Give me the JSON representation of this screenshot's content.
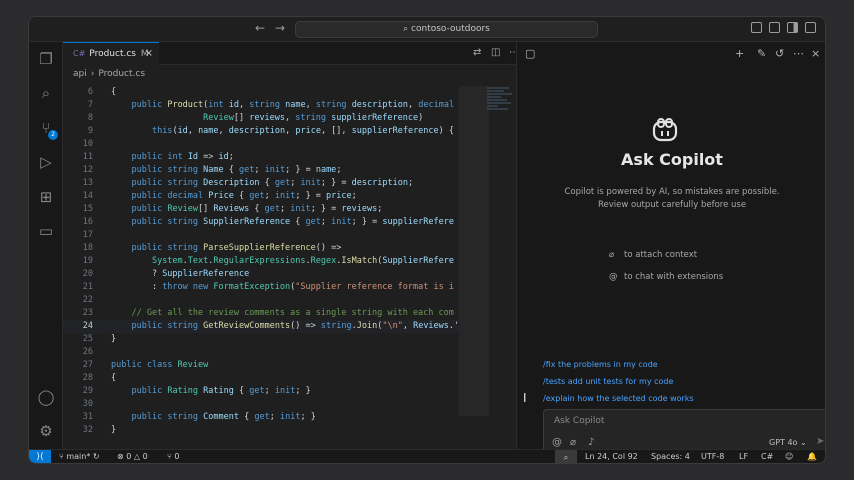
{
  "titlebar": {
    "search_text": "contoso-outdoors"
  },
  "activity_bar": {
    "scm_badge": "2"
  },
  "editor": {
    "tab_label": "Product.cs",
    "tab_modified": "M",
    "breadcrumb": [
      "api",
      "Product.cs"
    ],
    "active_line": 24,
    "lines": [
      {
        "n": 6,
        "html": "{"
      },
      {
        "n": 7,
        "html": "    <span class=\"c-kw\">public</span> <span class=\"c-fn\">Product</span>(<span class=\"c-kw\">int</span> <span class=\"c-p\">id</span>, <span class=\"c-kw\">string</span> <span class=\"c-p\">name</span>, <span class=\"c-kw\">string</span> <span class=\"c-p\">description</span>, <span class=\"c-kw\">decimal</span>"
      },
      {
        "n": 8,
        "html": "                  <span class=\"c-ty\">Review</span>[] <span class=\"c-p\">reviews</span>, <span class=\"c-kw\">string</span> <span class=\"c-p\">supplierReference</span>)"
      },
      {
        "n": 9,
        "html": "        <span class=\"c-kw\">this</span>(<span class=\"c-p\">id</span>, <span class=\"c-p\">name</span>, <span class=\"c-p\">description</span>, <span class=\"c-p\">price</span>, [], <span class=\"c-p\">supplierReference</span>) {"
      },
      {
        "n": 10,
        "html": ""
      },
      {
        "n": 11,
        "html": "    <span class=\"c-kw\">public</span> <span class=\"c-kw\">int</span> <span class=\"c-p\">Id</span> =&gt; <span class=\"c-p\">id</span>;"
      },
      {
        "n": 12,
        "html": "    <span class=\"c-kw\">public</span> <span class=\"c-kw\">string</span> <span class=\"c-p\">Name</span> { <span class=\"c-kw\">get</span>; <span class=\"c-kw\">init</span>; } = <span class=\"c-p\">name</span>;"
      },
      {
        "n": 13,
        "html": "    <span class=\"c-kw\">public</span> <span class=\"c-kw\">string</span> <span class=\"c-p\">Description</span> { <span class=\"c-kw\">get</span>; <span class=\"c-kw\">init</span>; } = <span class=\"c-p\">description</span>;"
      },
      {
        "n": 14,
        "html": "    <span class=\"c-kw\">public</span> <span class=\"c-kw\">decimal</span> <span class=\"c-p\">Price</span> { <span class=\"c-kw\">get</span>; <span class=\"c-kw\">init</span>; } = <span class=\"c-p\">price</span>;"
      },
      {
        "n": 15,
        "html": "    <span class=\"c-kw\">public</span> <span class=\"c-ty\">Review</span>[] <span class=\"c-p\">Reviews</span> { <span class=\"c-kw\">get</span>; <span class=\"c-kw\">init</span>; } = <span class=\"c-p\">reviews</span>;"
      },
      {
        "n": 16,
        "html": "    <span class=\"c-kw\">public</span> <span class=\"c-kw\">string</span> <span class=\"c-p\">SupplierReference</span> { <span class=\"c-kw\">get</span>; <span class=\"c-kw\">init</span>; } = <span class=\"c-p\">supplierRefere</span>"
      },
      {
        "n": 17,
        "html": ""
      },
      {
        "n": 18,
        "html": "    <span class=\"c-kw\">public</span> <span class=\"c-kw\">string</span> <span class=\"c-fn\">ParseSupplierReference</span>() =&gt;"
      },
      {
        "n": 19,
        "html": "        <span class=\"c-ty\">System</span>.<span class=\"c-ty\">Text</span>.<span class=\"c-ty\">RegularExpressions</span>.<span class=\"c-ty\">Regex</span>.<span class=\"c-fn\">IsMatch</span>(<span class=\"c-p\">SupplierRefere</span>"
      },
      {
        "n": 20,
        "html": "        ? <span class=\"c-p\">SupplierReference</span>"
      },
      {
        "n": 21,
        "html": "        : <span class=\"c-kw\">throw</span> <span class=\"c-kw\">new</span> <span class=\"c-ty\">FormatException</span>(<span class=\"c-str\">\"Supplier reference format is i</span>"
      },
      {
        "n": 22,
        "html": ""
      },
      {
        "n": 23,
        "html": "    <span class=\"c-cm\">// Get all the review comments as a single string with each com</span>"
      },
      {
        "n": 24,
        "html": "    <span class=\"c-kw\">public</span> <span class=\"c-kw\">string</span> <span class=\"c-fn\">GetReviewComments</span>() =&gt; <span class=\"c-kw\">string</span>.<span class=\"c-fn\">Join</span>(<span class=\"c-str\">\"\\n\"</span>, <span class=\"c-p\">Reviews</span>.'"
      },
      {
        "n": 25,
        "html": "}"
      },
      {
        "n": 26,
        "html": ""
      },
      {
        "n": 27,
        "html": "<span class=\"c-kw\">public</span> <span class=\"c-kw\">class</span> <span class=\"c-ty\">Review</span>"
      },
      {
        "n": 28,
        "html": "{"
      },
      {
        "n": 29,
        "html": "    <span class=\"c-kw\">public</span> <span class=\"c-ty\">Rating</span> <span class=\"c-p\">Rating</span> { <span class=\"c-kw\">get</span>; <span class=\"c-kw\">init</span>; }"
      },
      {
        "n": 30,
        "html": ""
      },
      {
        "n": 31,
        "html": "    <span class=\"c-kw\">public</span> <span class=\"c-kw\">string</span> <span class=\"c-p\">Comment</span> { <span class=\"c-kw\">get</span>; <span class=\"c-kw\">init</span>; }"
      },
      {
        "n": 32,
        "html": "}"
      }
    ]
  },
  "chat": {
    "title": "Ask Copilot",
    "disclaimer_line1": "Copilot is powered by AI, so mistakes are possible.",
    "disclaimer_line2": "Review output carefully before use",
    "hint_attach": "to attach context",
    "hint_extensions": "to chat with extensions",
    "suggestions": [
      "/fix the problems in my code",
      "/tests add unit tests for my code",
      "/explain how the selected code works"
    ],
    "input_placeholder": "Ask Copilot",
    "model": "GPT 4o"
  },
  "statusbar": {
    "branch": "main*",
    "errors": "0",
    "warnings": "0",
    "ports": "0",
    "position": "Ln 24, Col 92",
    "spaces": "Spaces: 4",
    "encoding": "UTF-8",
    "eol": "LF",
    "language": "C#"
  },
  "colors": {
    "accent": "#0078d4",
    "link": "#4aa3ff"
  }
}
